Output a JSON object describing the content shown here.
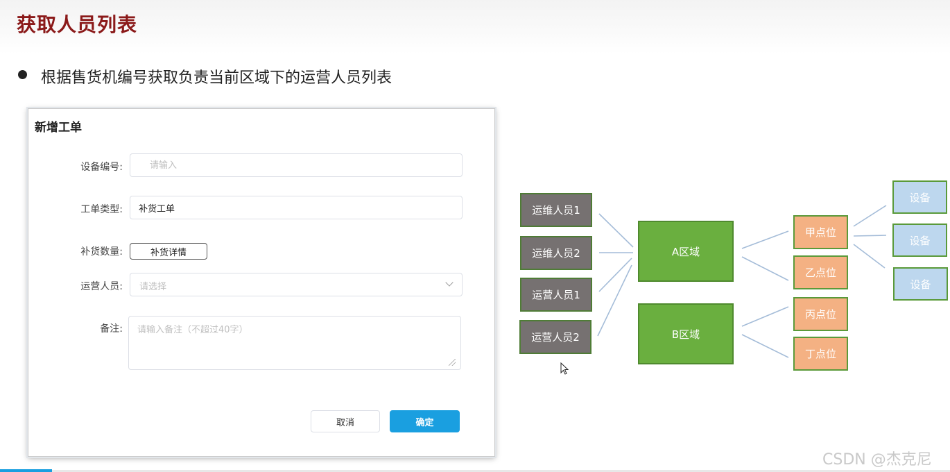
{
  "slide": {
    "title": "获取人员列表",
    "bullet": "根据售货机编号获取负责当前区域下的运营人员列表"
  },
  "dialog": {
    "title": "新增工单",
    "fields": {
      "device_label": "设备编号:",
      "device_placeholder": "请输入",
      "type_label": "工单类型:",
      "type_value": "补货工单",
      "qty_label": "补货数量:",
      "qty_button": "补货详情",
      "staff_label": "运营人员:",
      "staff_placeholder": "请选择",
      "remark_label": "备注:",
      "remark_placeholder": "请输入备注（不超过40字）"
    },
    "buttons": {
      "cancel": "取消",
      "confirm": "确定"
    }
  },
  "diagram": {
    "staff": [
      "运维人员1",
      "运维人员2",
      "运营人员1",
      "运营人员2"
    ],
    "regions": [
      "A区域",
      "B区域"
    ],
    "points": [
      "甲点位",
      "乙点位",
      "丙点位",
      "丁点位"
    ],
    "devices": [
      "设备",
      "设备",
      "设备"
    ]
  },
  "watermark": "CSDN @杰克尼",
  "colors": {
    "title": "#8b1a1a",
    "primary": "#1a9fe0",
    "staff_box": "#767171",
    "region_box": "#6aaf3f",
    "point_box": "#f4b183",
    "device_box": "#bdd7ee",
    "connector": "#a4bcd8"
  }
}
